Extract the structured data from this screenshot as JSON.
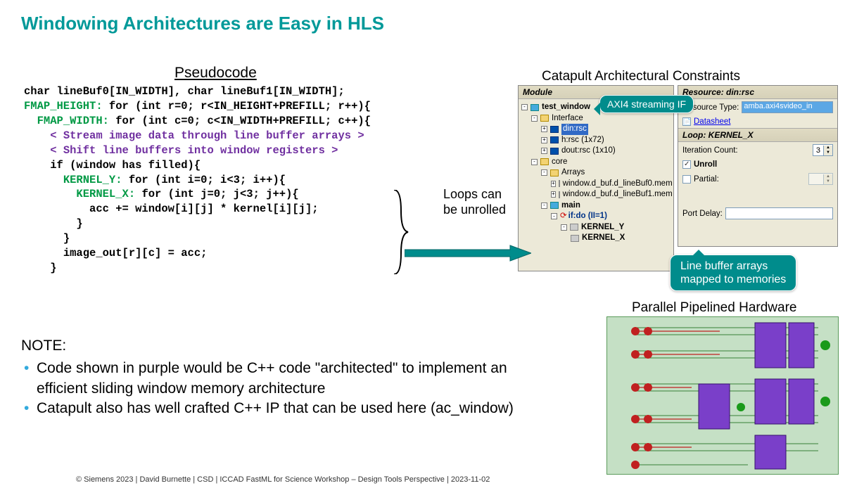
{
  "title": "Windowing Architectures are Easy in HLS",
  "pseudocode_header": "Pseudocode",
  "code": {
    "l1": "char lineBuf0[IN_WIDTH], char lineBuf1[IN_WIDTH];",
    "l2a": "FMAP_HEIGHT:",
    "l2b": " for (int r=0; r<IN_HEIGHT+PREFILL; r++){",
    "l3a": "FMAP_WIDTH:",
    "l3b": " for (int c=0; c<IN_WIDTH+PREFILL; c++){",
    "l4": "< Stream image data through line buffer arrays >",
    "l5": "< Shift line buffers into window registers >",
    "l6": "if (window has filled){",
    "l7a": "KERNEL_Y:",
    "l7b": " for (int i=0; i<3; i++){",
    "l8a": "KERNEL_X:",
    "l8b": " for (int j=0; j<3; j++){",
    "l9": "acc += window[i][j] * kernel[i][j];",
    "l10": "}",
    "l11": "}",
    "l12": "image_out[r][c] = acc;",
    "l13": "}"
  },
  "annotation_loops": "Loops can\nbe unrolled",
  "arch_header": "Catapult Architectural Constraints",
  "module_panel": {
    "title": "Module",
    "tree": {
      "root": "test_window",
      "interface": "Interface",
      "din": "din:rsc",
      "h": "h:rsc  (1x72)",
      "dout": "dout:rsc  (1x10)",
      "core": "core",
      "arrays": "Arrays",
      "arr1": "window.d_buf.d_lineBuf0.mem",
      "arr2": "window.d_buf.d_lineBuf1.mem",
      "main": "main",
      "ifdo": "if:do (II=1)",
      "ky": "KERNEL_Y",
      "kx": "KERNEL_X"
    }
  },
  "resource_panel": {
    "title": "Resource: din:rsc",
    "type_label": "Resource Type:",
    "type_value": "amba.axi4svideo_in",
    "datasheet": "Datasheet",
    "loop_title": "Loop: KERNEL_X",
    "iter_label": "Iteration Count:",
    "iter_value": "3",
    "unroll_label": "Unroll",
    "partial_label": "Partial:",
    "portdelay_label": "Port Delay:"
  },
  "callout_axi": "AXI4 streaming IF",
  "callout_linebuf": "Line buffer arrays\nmapped to memories",
  "note_heading": "NOTE:",
  "note1": "Code shown in purple would be C++ code \"architected\" to implement an efficient sliding window memory architecture",
  "note2": "Catapult also has well crafted C++ IP that can be used here (ac_window)",
  "hw_header": "Parallel Pipelined Hardware",
  "footer": "© Siemens 2023 | David Burnette | CSD | ICCAD FastML for Science Workshop – Design Tools Perspective | 2023-11-02"
}
